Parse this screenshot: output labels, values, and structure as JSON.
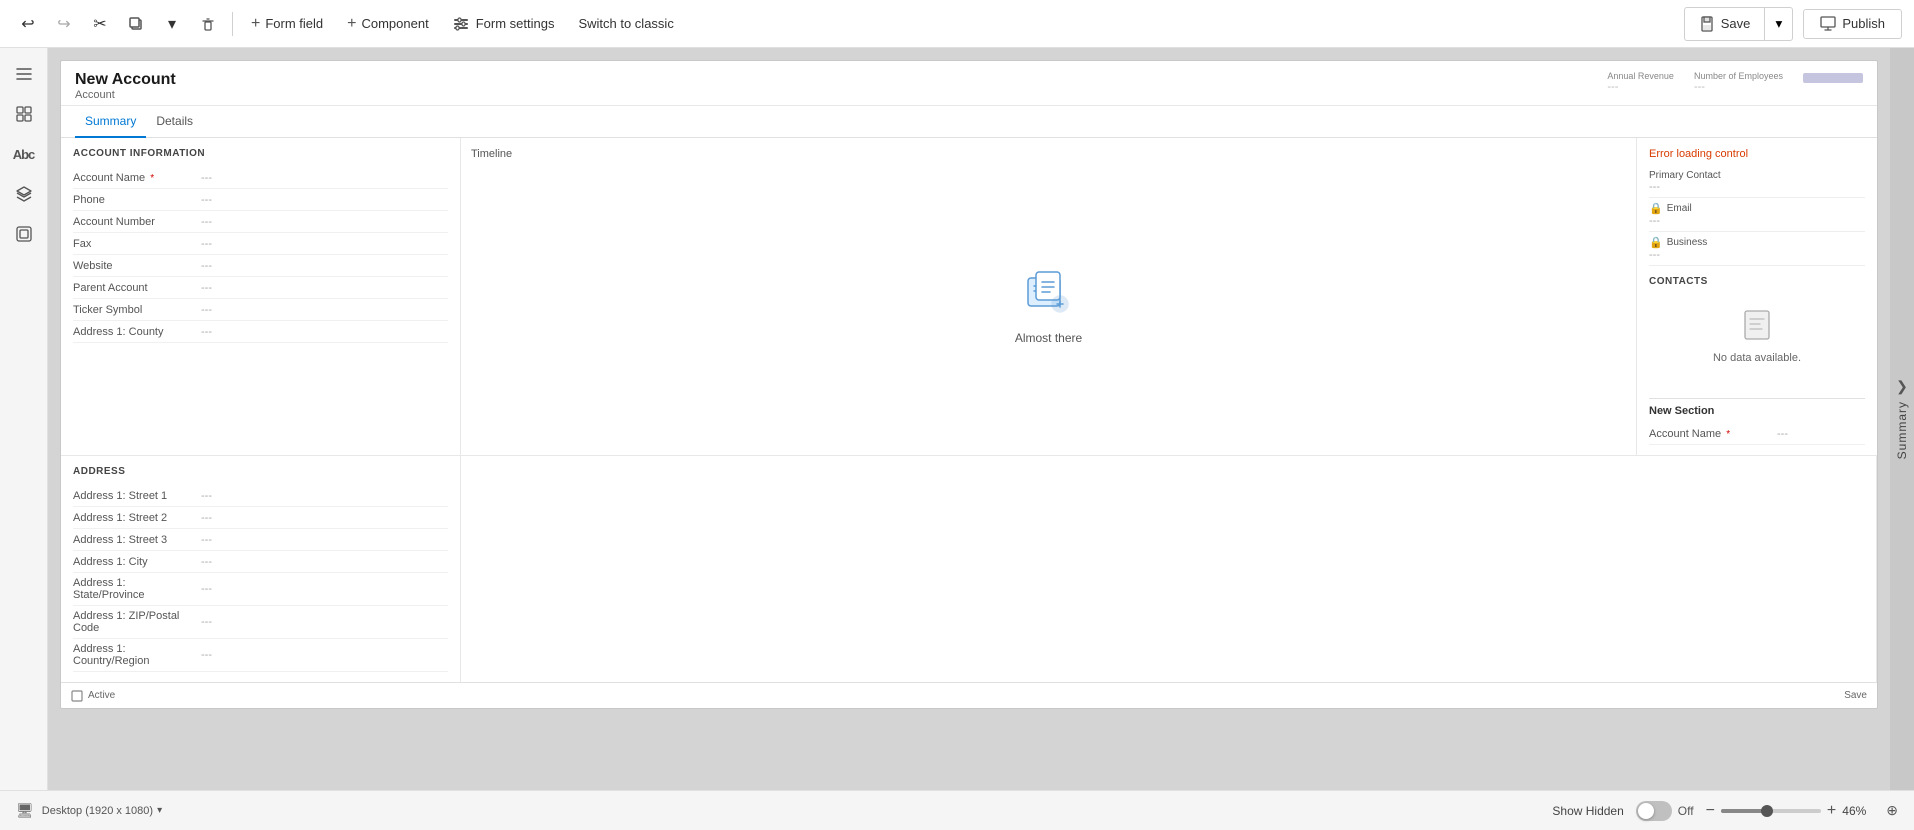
{
  "toolbar": {
    "undo_label": "↩",
    "redo_label": "↪",
    "cut_label": "✂",
    "copy_label": "⧉",
    "chevron_label": "▾",
    "delete_label": "🗑",
    "form_field_label": "Form field",
    "component_label": "Component",
    "form_settings_label": "Form settings",
    "switch_classic_label": "Switch to classic",
    "save_label": "Save",
    "publish_label": "Publish",
    "save_icon": "💾",
    "publish_icon": "📤"
  },
  "sidebar": {
    "items": [
      {
        "icon": "☰",
        "name": "menu"
      },
      {
        "icon": "⊞",
        "name": "dashboard"
      },
      {
        "icon": "Abc",
        "name": "text"
      },
      {
        "icon": "⧉",
        "name": "layers"
      },
      {
        "icon": "⊡",
        "name": "components"
      }
    ]
  },
  "form": {
    "title": "New Account",
    "subtitle": "Account",
    "meta": [
      {
        "label": "Annual Revenue",
        "value": "---"
      },
      {
        "label": "Number of Employees",
        "value": "---"
      }
    ],
    "tabs": [
      {
        "label": "Summary",
        "active": true
      },
      {
        "label": "Details",
        "active": false
      }
    ],
    "account_info_section": {
      "title": "ACCOUNT INFORMATION",
      "fields": [
        {
          "label": "Account Name",
          "required": true,
          "value": "---"
        },
        {
          "label": "Phone",
          "required": false,
          "value": "---"
        },
        {
          "label": "Account Number",
          "required": false,
          "value": "---"
        },
        {
          "label": "Fax",
          "required": false,
          "value": "---"
        },
        {
          "label": "Website",
          "required": false,
          "value": "---"
        },
        {
          "label": "Parent Account",
          "required": false,
          "value": "---"
        },
        {
          "label": "Ticker Symbol",
          "required": false,
          "value": "---"
        },
        {
          "label": "Address 1: County",
          "required": false,
          "value": "---"
        }
      ]
    },
    "address_section": {
      "title": "ADDRESS",
      "fields": [
        {
          "label": "Address 1: Street 1",
          "value": "---"
        },
        {
          "label": "Address 1: Street 2",
          "value": "---"
        },
        {
          "label": "Address 1: Street 3",
          "value": "---"
        },
        {
          "label": "Address 1: City",
          "value": "---"
        },
        {
          "label": "Address 1: State/Province",
          "value": "---"
        },
        {
          "label": "Address 1: ZIP/Postal Code",
          "value": "---"
        },
        {
          "label": "Address 1: Country/Region",
          "value": "---"
        }
      ]
    },
    "timeline_section": {
      "label": "Timeline",
      "almost_there": "Almost there"
    },
    "right_section": {
      "error_label": "Error loading control",
      "primary_contact_label": "Primary Contact",
      "primary_contact_value": "---",
      "email_label": "Email",
      "email_value": "---",
      "business_label": "Business",
      "business_value": "---",
      "contacts_label": "CONTACTS",
      "no_data_label": "No data available.",
      "new_section_label": "New Section",
      "account_name_label": "Account Name",
      "account_name_required": "*",
      "account_name_value": "---"
    }
  },
  "status_bar": {
    "status_icon": "🖥",
    "status_text": "Active",
    "device_label": "Desktop (1920 x 1080)",
    "show_hidden_label": "Show Hidden",
    "toggle_state": "Off",
    "zoom_minus": "−",
    "zoom_plus": "+",
    "zoom_level": "46%",
    "target_icon": "⊕",
    "save_label": "Save"
  },
  "right_panel": {
    "label": "Summary"
  }
}
